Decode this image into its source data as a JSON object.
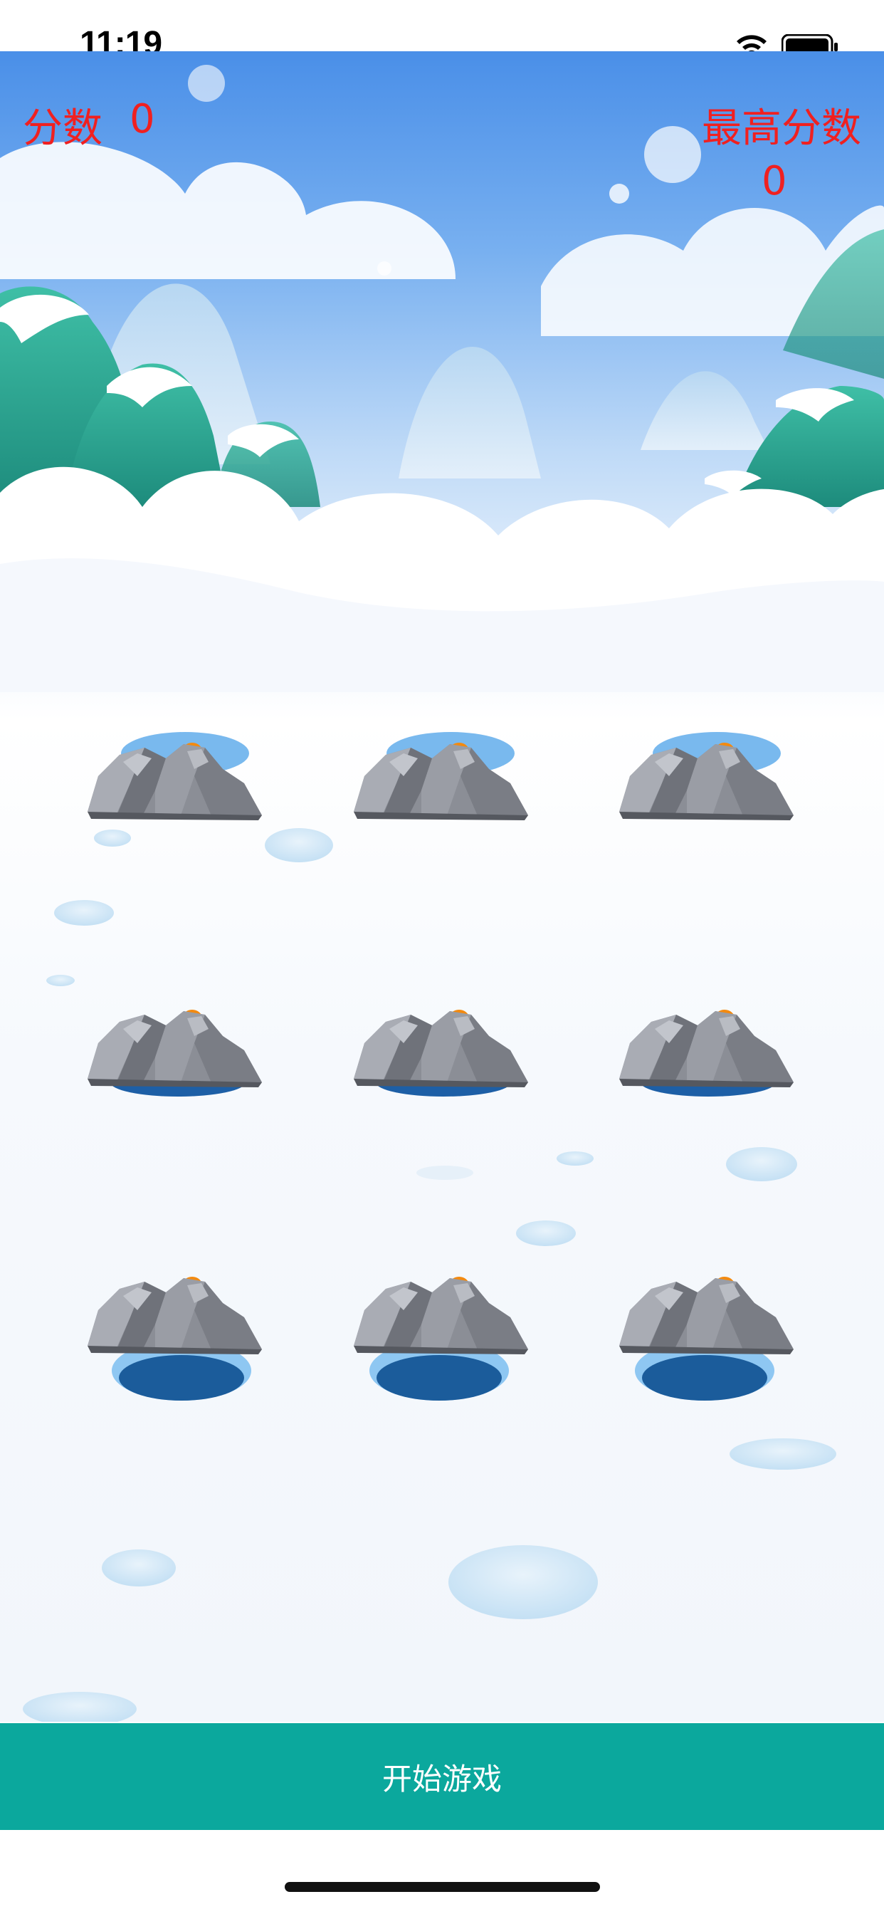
{
  "status_bar": {
    "time": "11:19"
  },
  "score": {
    "label": "分数",
    "value": "0"
  },
  "best_score": {
    "label": "最高分数",
    "value": "0"
  },
  "holes": [
    {
      "row": 1,
      "col": 1
    },
    {
      "row": 1,
      "col": 2
    },
    {
      "row": 1,
      "col": 3
    },
    {
      "row": 2,
      "col": 1
    },
    {
      "row": 2,
      "col": 2
    },
    {
      "row": 2,
      "col": 3
    },
    {
      "row": 3,
      "col": 1
    },
    {
      "row": 3,
      "col": 2
    },
    {
      "row": 3,
      "col": 3
    }
  ],
  "start_button": {
    "label": "开始游戏"
  },
  "colors": {
    "score_text": "#f02020",
    "button_bg": "#0ba89d",
    "button_text": "#ffffff"
  }
}
